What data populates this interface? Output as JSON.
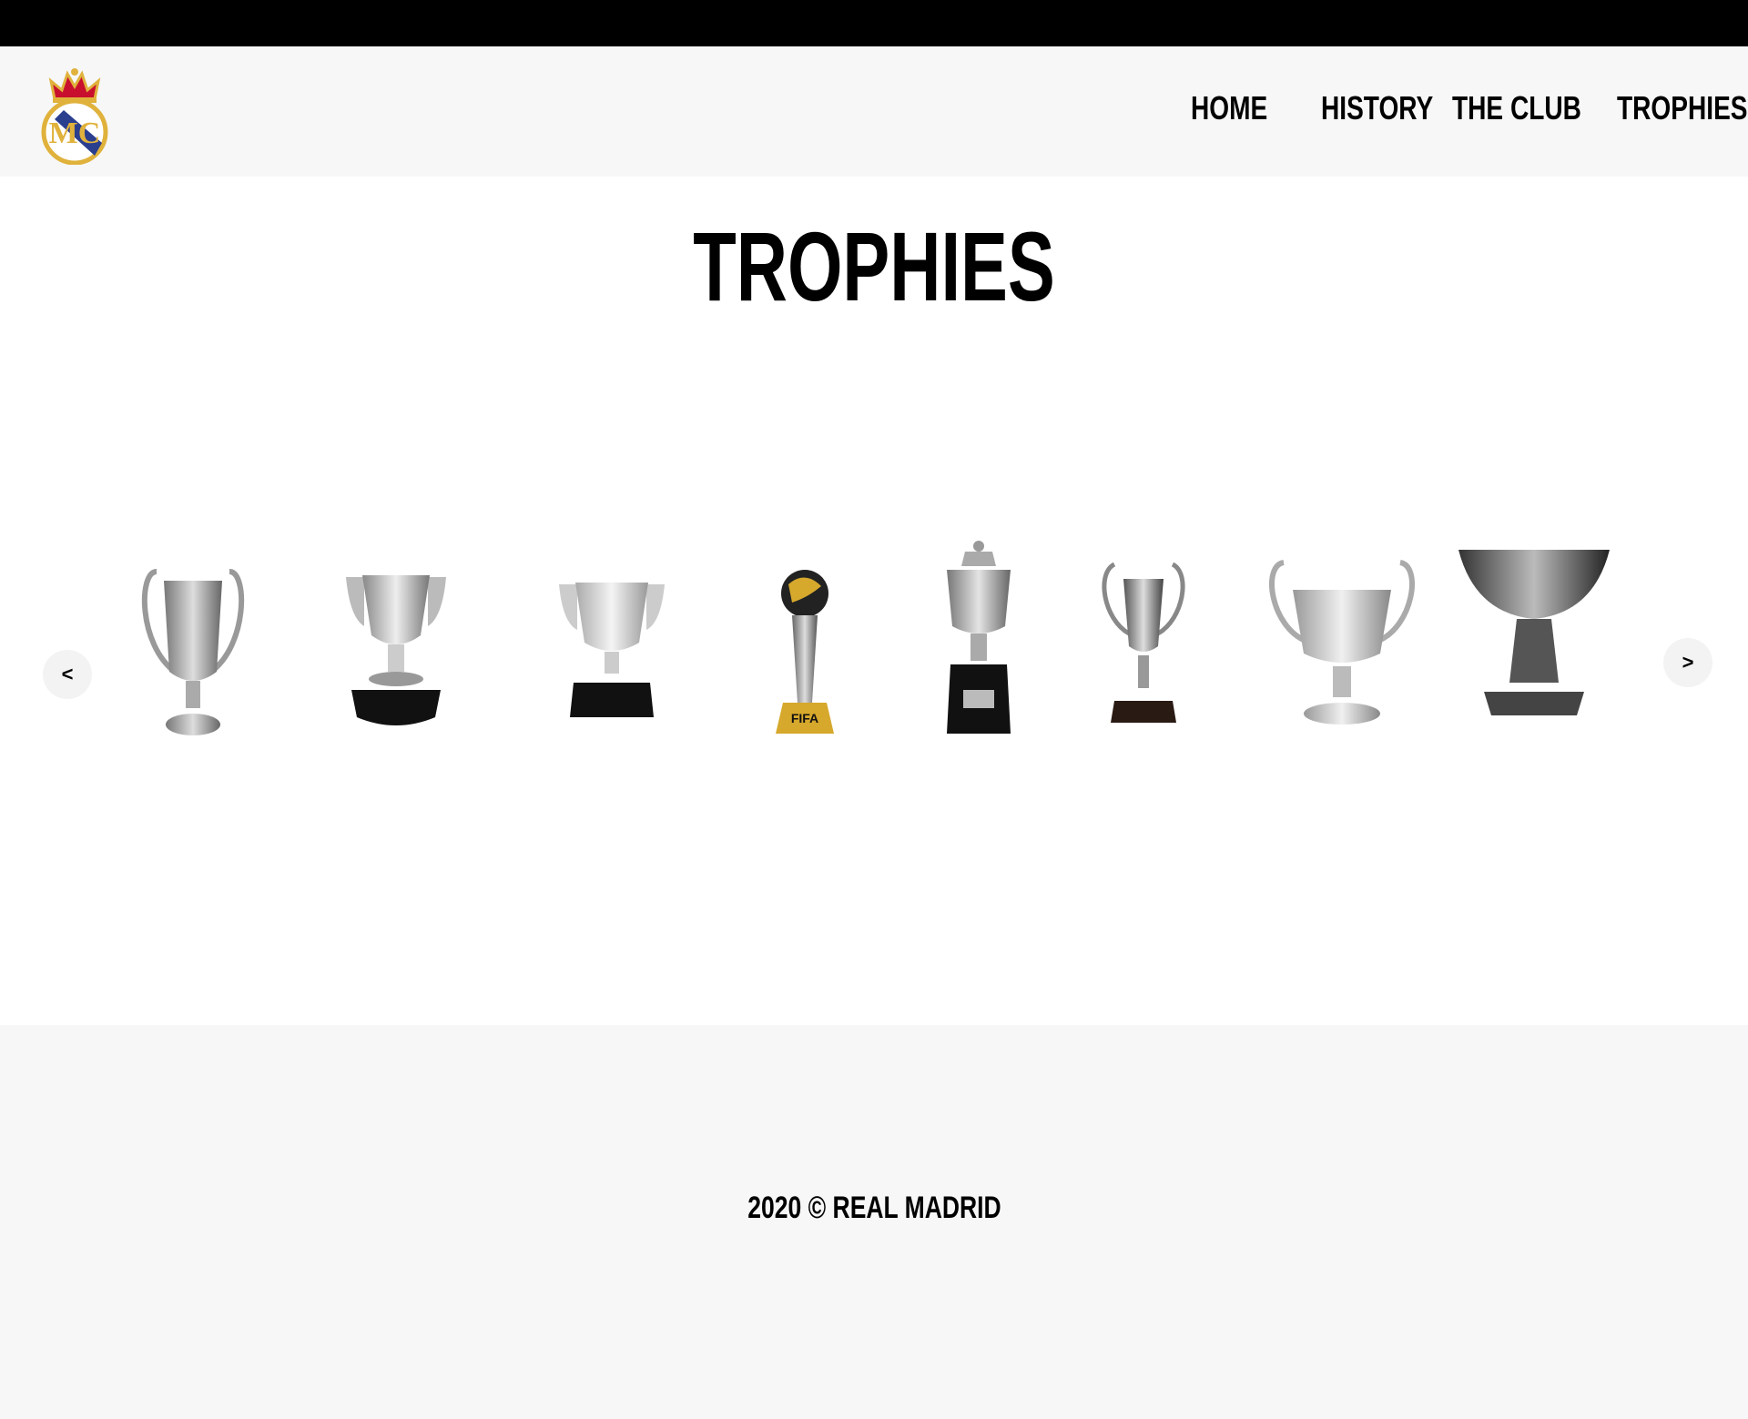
{
  "header": {
    "logo_icon": "real-madrid-crest-icon",
    "nav": [
      {
        "label": "HOME"
      },
      {
        "label": "HISTORY"
      },
      {
        "label": "THE CLUB"
      },
      {
        "label": "TROPHIES"
      }
    ]
  },
  "main": {
    "title": "TROPHIES",
    "carousel": {
      "prev_label": "<",
      "next_label": ">",
      "trophies": [
        {
          "icon": "champions-league-trophy-icon"
        },
        {
          "icon": "laliga-trophy-icon"
        },
        {
          "icon": "campeonato-nacional-liga-trophy-icon"
        },
        {
          "icon": "fifa-club-world-cup-trophy-icon"
        },
        {
          "icon": "supercopa-trophy-icon"
        },
        {
          "icon": "copa-del-rey-trophy-icon"
        },
        {
          "icon": "uefa-cup-trophy-icon"
        },
        {
          "icon": "super-cup-bowl-trophy-icon"
        }
      ]
    }
  },
  "footer": {
    "copyright": "2020 © REAL MADRID"
  },
  "colors": {
    "topbar": "#000000",
    "header_bg": "#f7f7f7",
    "footer_bg": "#f7f7f7",
    "crest_gold": "#e0b23c",
    "crest_blue": "#2b3f8f",
    "crown_red": "#c8102e"
  }
}
